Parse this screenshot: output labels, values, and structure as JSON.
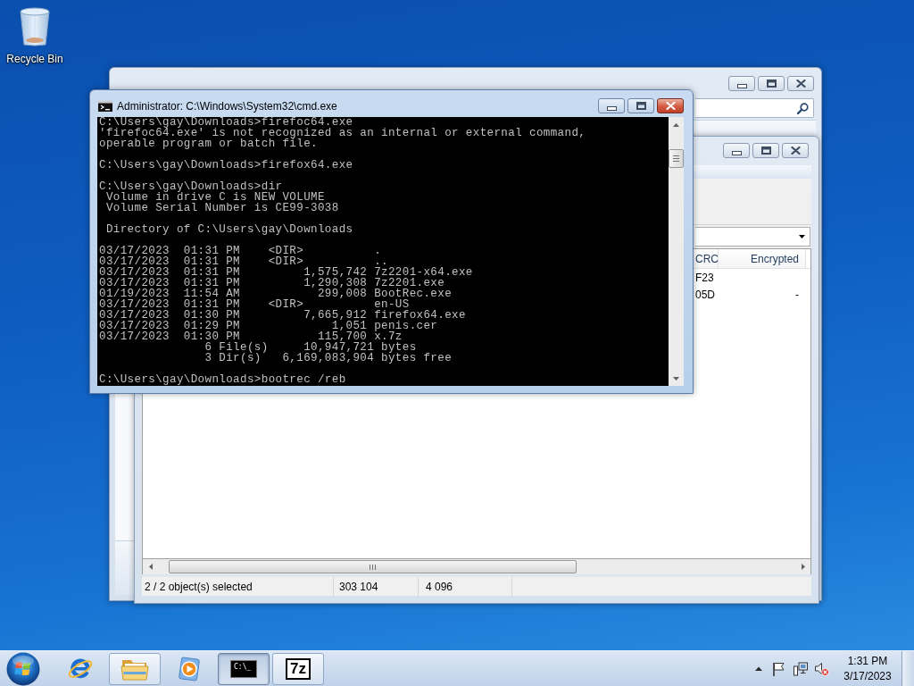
{
  "desktop": {
    "icons": [
      {
        "label": "Recycle Bin"
      }
    ]
  },
  "windows": [
    {
      "kind": "explorer",
      "active": false
    },
    {
      "kind": "archive_manager",
      "active": false,
      "list": {
        "columns": [
          "CRC",
          "Encrypted"
        ],
        "rows": [
          [
            "F23"
          ],
          [
            "05D",
            "-"
          ]
        ]
      },
      "status_bar": [
        "2 / 2 object(s) selected",
        "303 104",
        "4 096"
      ]
    },
    {
      "kind": "console",
      "active": true,
      "title": "Administrator: C:\\Windows\\System32\\cmd.exe",
      "blocks": [
        [
          "C:\\Users\\gay\\Downloads>firefoc64.exe",
          "'firefoc64.exe' is not recognized as an internal or external command,",
          "operable program or batch file."
        ],
        [
          "C:\\Users\\gay\\Downloads>firefox64.exe"
        ],
        [
          "C:\\Users\\gay\\Downloads>dir",
          " Volume in drive C is NEW VOLUME",
          " Volume Serial Number is CE99-3038"
        ],
        [
          " Directory of C:\\Users\\gay\\Downloads"
        ],
        [
          "03/17/2023  01:31 PM    <DIR>          .",
          "03/17/2023  01:31 PM    <DIR>          ..",
          "03/17/2023  01:31 PM         1,575,742 7z2201-x64.exe",
          "03/17/2023  01:31 PM         1,290,308 7z2201.exe",
          "01/19/2023  11:54 AM           299,008 BootRec.exe",
          "03/17/2023  01:31 PM    <DIR>          en-US",
          "03/17/2023  01:30 PM         7,665,912 firefox64.exe",
          "03/17/2023  01:29 PM             1,051 penis.cer",
          "03/17/2023  01:30 PM           115,700 x.7z",
          "               6 File(s)     10,947,721 bytes",
          "               3 Dir(s)   6,169,083,904 bytes free"
        ],
        [
          "C:\\Users\\gay\\Downloads>bootrec /reb"
        ]
      ]
    }
  ],
  "taskbar": {
    "items": [
      {
        "kind": "browser",
        "running": false,
        "selected": false
      },
      {
        "kind": "file_manager",
        "running": true,
        "selected": false
      },
      {
        "kind": "media_player",
        "running": false,
        "selected": false
      },
      {
        "kind": "console",
        "running": true,
        "selected": true,
        "text": "C:\\_"
      },
      {
        "kind": "archiver",
        "running": true,
        "selected": false,
        "text": "7z"
      }
    ],
    "tray": {
      "volume_muted": true,
      "clock": {
        "time": "1:31 PM",
        "date": "3/17/2023"
      }
    }
  }
}
